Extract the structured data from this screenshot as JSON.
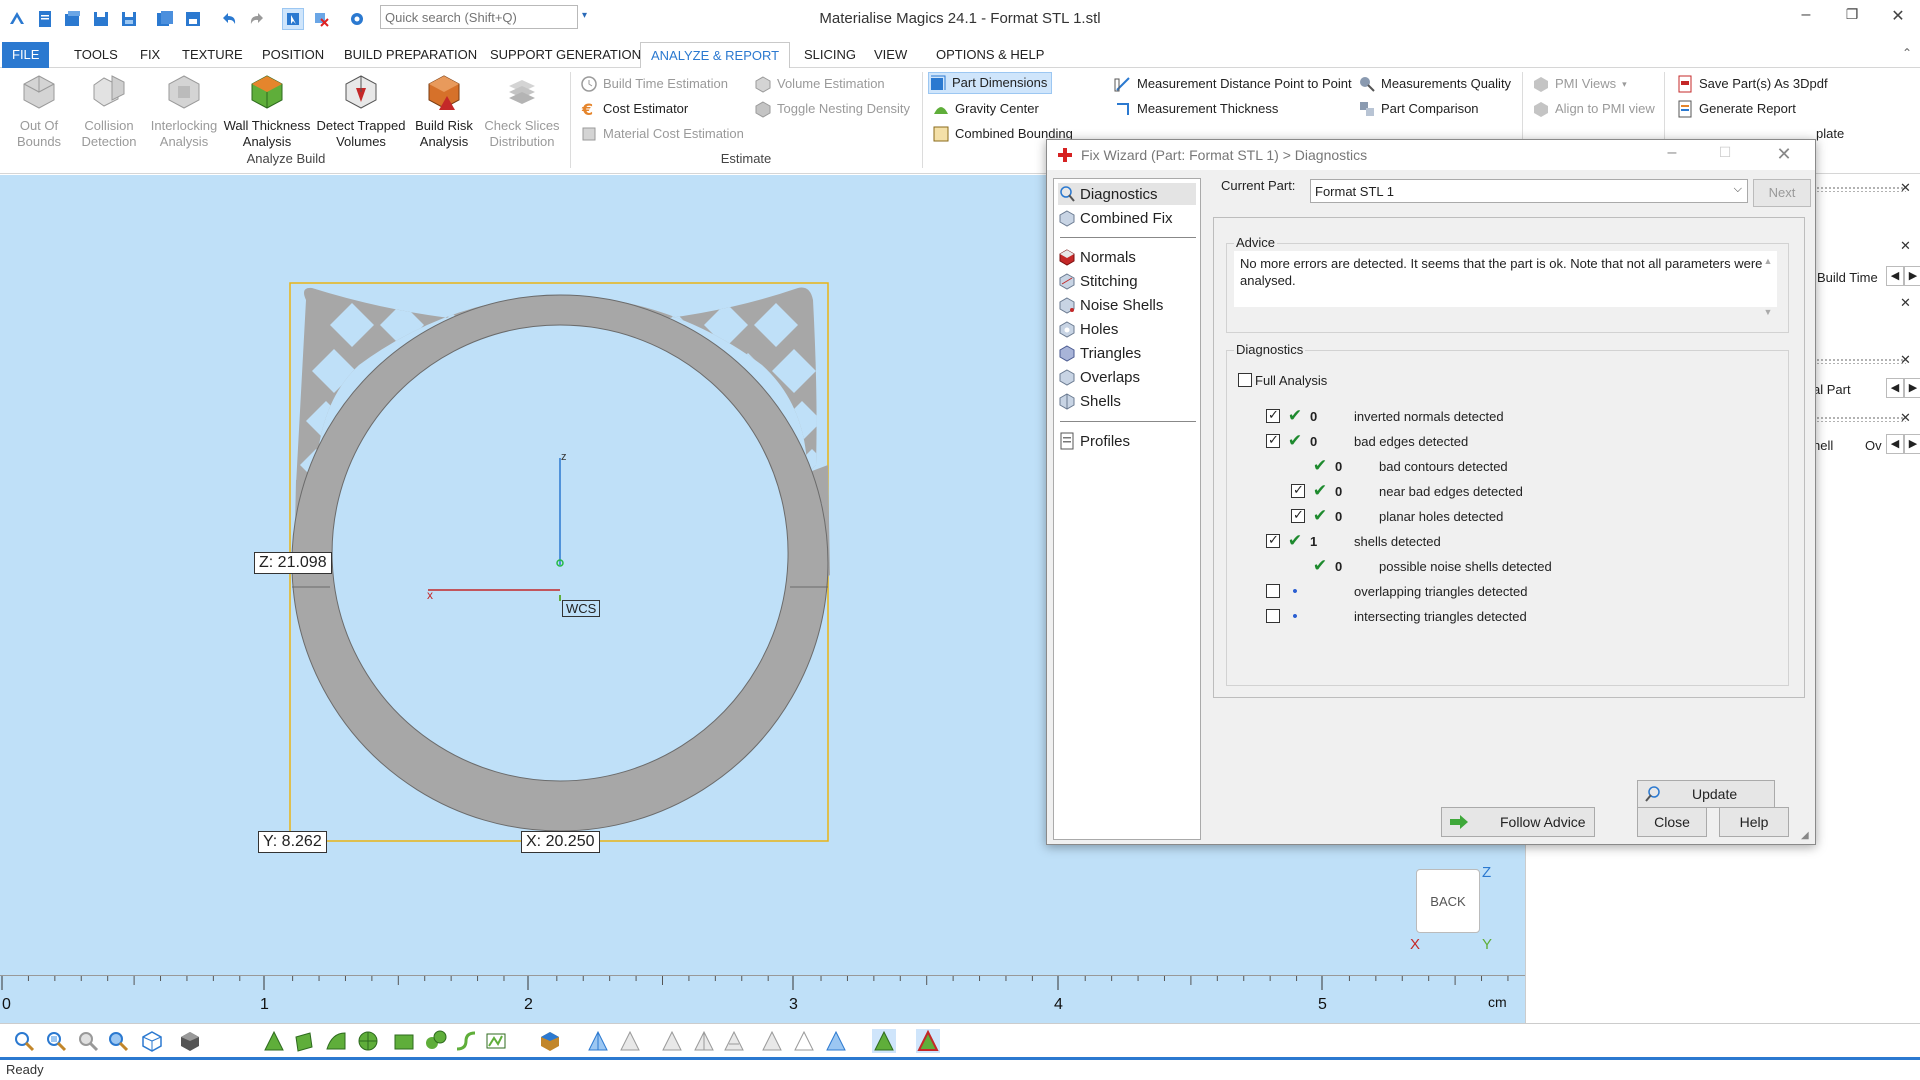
{
  "window": {
    "title": "Materialise Magics 24.1 - Format STL 1.stl"
  },
  "quick_access": {
    "search_placeholder": "Quick search (Shift+Q)",
    "icons": [
      "logo-icon",
      "new-file-icon",
      "open-icon",
      "save-icon",
      "save-as-icon",
      "open-project-icon",
      "save-project-icon",
      "undo-icon",
      "redo-icon",
      "select-icon",
      "deselect-icon",
      "settings-icon"
    ]
  },
  "window_controls": {
    "minimize": "–",
    "restore": "❐",
    "close": "✕"
  },
  "ribbon_tabs": [
    "FILE",
    "TOOLS",
    "FIX",
    "TEXTURE",
    "POSITION",
    "BUILD PREPARATION",
    "SUPPORT GENERATION",
    "ANALYZE & REPORT",
    "SLICING",
    "VIEW",
    "OPTIONS & HELP"
  ],
  "active_tab": "ANALYZE & REPORT",
  "ribbon": {
    "analyze_build": {
      "label": "Analyze Build",
      "buttons": [
        {
          "label1": "Out Of",
          "label2": "Bounds",
          "icon": "out-of-bounds-icon",
          "disabled": true
        },
        {
          "label1": "Collision",
          "label2": "Detection",
          "icon": "collision-detection-icon",
          "disabled": true
        },
        {
          "label1": "Interlocking",
          "label2": "Analysis",
          "icon": "interlocking-icon",
          "disabled": true
        },
        {
          "label1": "Wall Thickness",
          "label2": "Analysis",
          "icon": "wall-thickness-icon",
          "disabled": false
        },
        {
          "label1": "Detect Trapped",
          "label2": "Volumes",
          "icon": "trapped-volumes-icon",
          "disabled": false
        },
        {
          "label1": "Build Risk",
          "label2": "Analysis",
          "icon": "build-risk-icon",
          "disabled": false
        },
        {
          "label1": "Check Slices",
          "label2": "Distribution",
          "icon": "check-slices-icon",
          "disabled": true
        }
      ]
    },
    "estimate": {
      "label": "Estimate",
      "items": [
        {
          "label": "Build Time Estimation",
          "icon": "build-time-icon",
          "disabled": true
        },
        {
          "label": "Cost Estimator",
          "icon": "cost-estimator-icon",
          "disabled": false
        },
        {
          "label": "Material Cost Estimation",
          "icon": "material-cost-icon",
          "disabled": true
        },
        {
          "label": "Volume Estimation",
          "icon": "volume-estimation-icon",
          "disabled": true
        },
        {
          "label": "Toggle Nesting Density",
          "icon": "nesting-density-icon",
          "disabled": true
        }
      ]
    },
    "measure": {
      "items": [
        {
          "label": "Part Dimensions",
          "icon": "part-dimensions-icon",
          "highlighted": true
        },
        {
          "label": "Gravity Center",
          "icon": "gravity-center-icon"
        },
        {
          "label": "Combined Bounding",
          "icon": "combined-bounding-icon"
        },
        {
          "label": "Measurement Distance Point to Point",
          "icon": "measure-distance-icon"
        },
        {
          "label": "Measurement Thickness",
          "icon": "measure-thickness-icon"
        },
        {
          "label": "Measurements Quality",
          "icon": "measurements-quality-icon"
        },
        {
          "label": "Part Comparison",
          "icon": "part-comparison-icon"
        }
      ]
    },
    "pmi": {
      "items": [
        {
          "label": "PMI Views",
          "icon": "pmi-views-icon",
          "disabled": true
        },
        {
          "label": "Align to PMI view",
          "icon": "align-pmi-icon",
          "disabled": true
        }
      ]
    },
    "report": {
      "items": [
        {
          "label": "Save Part(s) As 3Dpdf",
          "icon": "save-3dpdf-icon"
        },
        {
          "label": "Generate Report",
          "icon": "generate-report-icon"
        },
        {
          "label": "plate",
          "icon": "report-template-icon"
        }
      ]
    }
  },
  "viewport": {
    "dims": {
      "z": "Z: 21.098",
      "y": "Y: 8.262",
      "x": "X: 20.250"
    },
    "axes": {
      "z": "z",
      "x": "x",
      "wcs": "WCS"
    },
    "view_cube": {
      "face": "BACK",
      "z": "Z",
      "x": "X",
      "y": "Y"
    },
    "ruler": {
      "labels": [
        "0",
        "1",
        "2",
        "3",
        "4",
        "5"
      ],
      "unit": "cm"
    }
  },
  "right_panel": {
    "rows": [
      {
        "text": "Build Time"
      },
      {
        "text": "al Part"
      },
      {
        "text": "hell",
        "text2": "Ov"
      }
    ]
  },
  "status": {
    "text": "Ready"
  },
  "dialog": {
    "title": "Fix Wizard (Part: Format STL 1) > Diagnostics",
    "nav": [
      {
        "label": "Diagnostics",
        "icon": "diagnostics-icon",
        "selected": true
      },
      {
        "label": "Combined Fix",
        "icon": "combined-fix-icon"
      },
      {
        "label": "Normals",
        "icon": "normals-icon"
      },
      {
        "label": "Stitching",
        "icon": "stitching-icon"
      },
      {
        "label": "Noise Shells",
        "icon": "noise-shells-icon"
      },
      {
        "label": "Holes",
        "icon": "holes-icon"
      },
      {
        "label": "Triangles",
        "icon": "triangles-icon"
      },
      {
        "label": "Overlaps",
        "icon": "overlaps-icon"
      },
      {
        "label": "Shells",
        "icon": "shells-icon"
      },
      {
        "label": "Profiles",
        "icon": "profiles-icon"
      }
    ],
    "current_part_label": "Current Part:",
    "current_part_value": "Format STL 1",
    "next_label": "Next",
    "advice_legend": "Advice",
    "advice_text": "No more errors are detected. It seems that the part is ok. Note that not all parameters were analysed.",
    "diagnostics_legend": "Diagnostics",
    "full_analysis_label": "Full Analysis",
    "full_analysis_checked": false,
    "rows": [
      {
        "checkbox": true,
        "checked": true,
        "status": "ok",
        "count": "0",
        "label": "inverted normals detected",
        "indent": 0
      },
      {
        "checkbox": true,
        "checked": true,
        "status": "ok",
        "count": "0",
        "label": "bad edges detected",
        "indent": 0
      },
      {
        "checkbox": false,
        "checked": false,
        "status": "ok",
        "count": "0",
        "label": "bad contours detected",
        "indent": 1
      },
      {
        "checkbox": true,
        "checked": true,
        "status": "ok",
        "count": "0",
        "label": "near bad edges detected",
        "indent": 1
      },
      {
        "checkbox": true,
        "checked": true,
        "status": "ok",
        "count": "0",
        "label": "planar holes detected",
        "indent": 1
      },
      {
        "checkbox": true,
        "checked": true,
        "status": "ok",
        "count": "1",
        "label": "shells detected",
        "indent": 0
      },
      {
        "checkbox": false,
        "checked": false,
        "status": "ok",
        "count": "0",
        "label": "possible noise shells detected",
        "indent": 1
      },
      {
        "checkbox": true,
        "checked": false,
        "status": "pending",
        "count": "",
        "label": "overlapping triangles detected",
        "indent": 0
      },
      {
        "checkbox": true,
        "checked": false,
        "status": "pending",
        "count": "",
        "label": "intersecting triangles detected",
        "indent": 0
      }
    ],
    "update_label": "Update",
    "follow_advice_label": "Follow Advice",
    "close_label": "Close",
    "help_label": "Help"
  },
  "colors": {
    "accent": "#2b79d0",
    "viewport_bg": "#bfe0f8",
    "ok_green": "#1e8a2e",
    "part_gray": "#a7a7a7",
    "bbox_yellow": "#e8b417"
  }
}
